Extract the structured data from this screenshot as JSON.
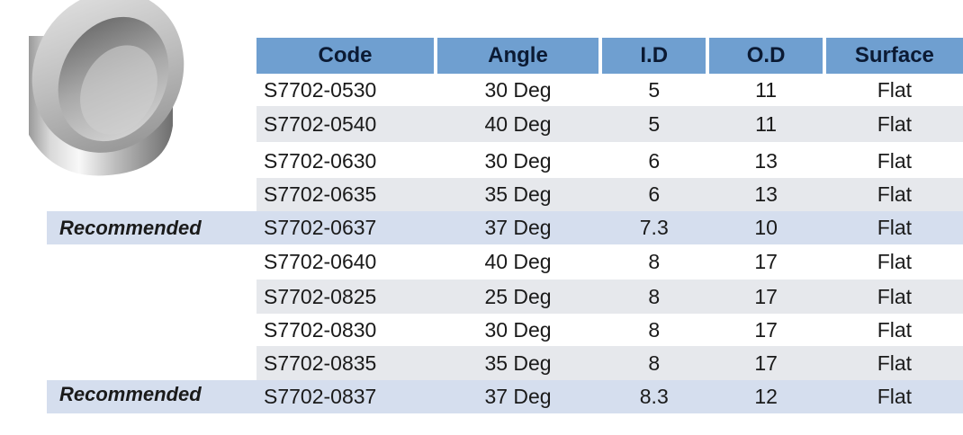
{
  "headers": [
    "Code",
    "Angle",
    "I.D",
    "O.D",
    "Surface"
  ],
  "rows": [
    {
      "code": "S7702-0530",
      "angle": "30 Deg",
      "id": "5",
      "od": "11",
      "surface": "Flat",
      "style": "white"
    },
    {
      "code": "S7702-0540",
      "angle": "40 Deg",
      "id": "5",
      "od": "11",
      "surface": "Flat",
      "style": "gray"
    },
    {
      "code": "S7702-0630",
      "angle": "30 Deg",
      "id": "6",
      "od": "13",
      "surface": "Flat",
      "style": "white"
    },
    {
      "code": "S7702-0635",
      "angle": "35 Deg",
      "id": "6",
      "od": "13",
      "surface": "Flat",
      "style": "gray"
    },
    {
      "code": "S7702-0637",
      "angle": "37 Deg",
      "id": "7.3",
      "od": "10",
      "surface": "Flat",
      "style": "blue"
    },
    {
      "code": "S7702-0640",
      "angle": "40 Deg",
      "id": "8",
      "od": "17",
      "surface": "Flat",
      "style": "white"
    },
    {
      "code": "S7702-0825",
      "angle": "25 Deg",
      "id": "8",
      "od": "17",
      "surface": "Flat",
      "style": "gray"
    },
    {
      "code": "S7702-0830",
      "angle": "30 Deg",
      "id": "8",
      "od": "17",
      "surface": "Flat",
      "style": "white"
    },
    {
      "code": "S7702-0835",
      "angle": "35 Deg",
      "id": "8",
      "od": "17",
      "surface": "Flat",
      "style": "gray"
    },
    {
      "code": "S7702-0837",
      "angle": "37 Deg",
      "id": "8.3",
      "od": "12",
      "surface": "Flat",
      "style": "blue"
    }
  ],
  "recommended_label": "Recommended",
  "colors": {
    "header": "#6f9fd0",
    "gray_row": "#e6e8ec",
    "recommended_row": "#d5deee"
  }
}
